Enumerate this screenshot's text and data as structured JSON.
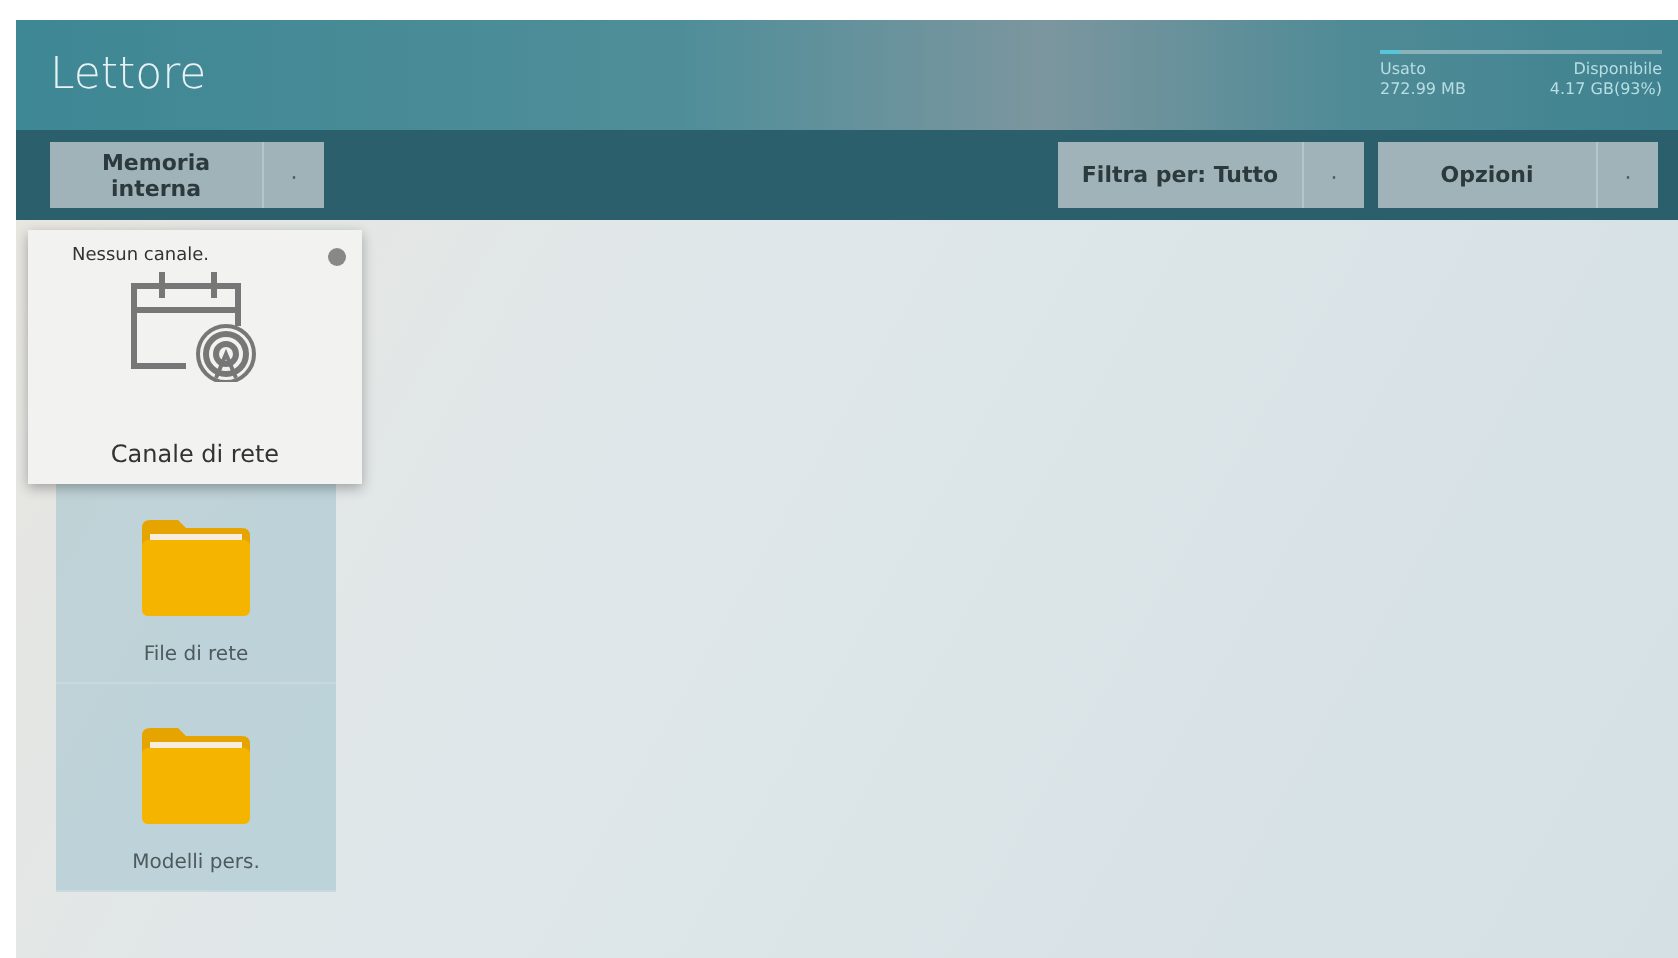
{
  "header": {
    "title": "Lettore",
    "storage": {
      "level": 0.07,
      "used_label": "Usato",
      "used_value": "272.99 MB",
      "free_label": "Disponibile",
      "free_value": "4.17 GB(93%)"
    }
  },
  "toolbar": {
    "left": [
      {
        "label": "Memoria interna",
        "caret": "·"
      }
    ],
    "right": [
      {
        "label": "Filtra per: Tutto",
        "caret": "·"
      },
      {
        "label": "Opzioni",
        "caret": "·"
      }
    ]
  },
  "items": [
    {
      "kind": "channel",
      "label": "Canale di rete",
      "note": "Nessun canale.",
      "focused": true
    },
    {
      "kind": "folder",
      "label": "File di rete",
      "focused": false
    },
    {
      "kind": "folder",
      "label": "Modelli pers.",
      "focused": false
    }
  ]
}
